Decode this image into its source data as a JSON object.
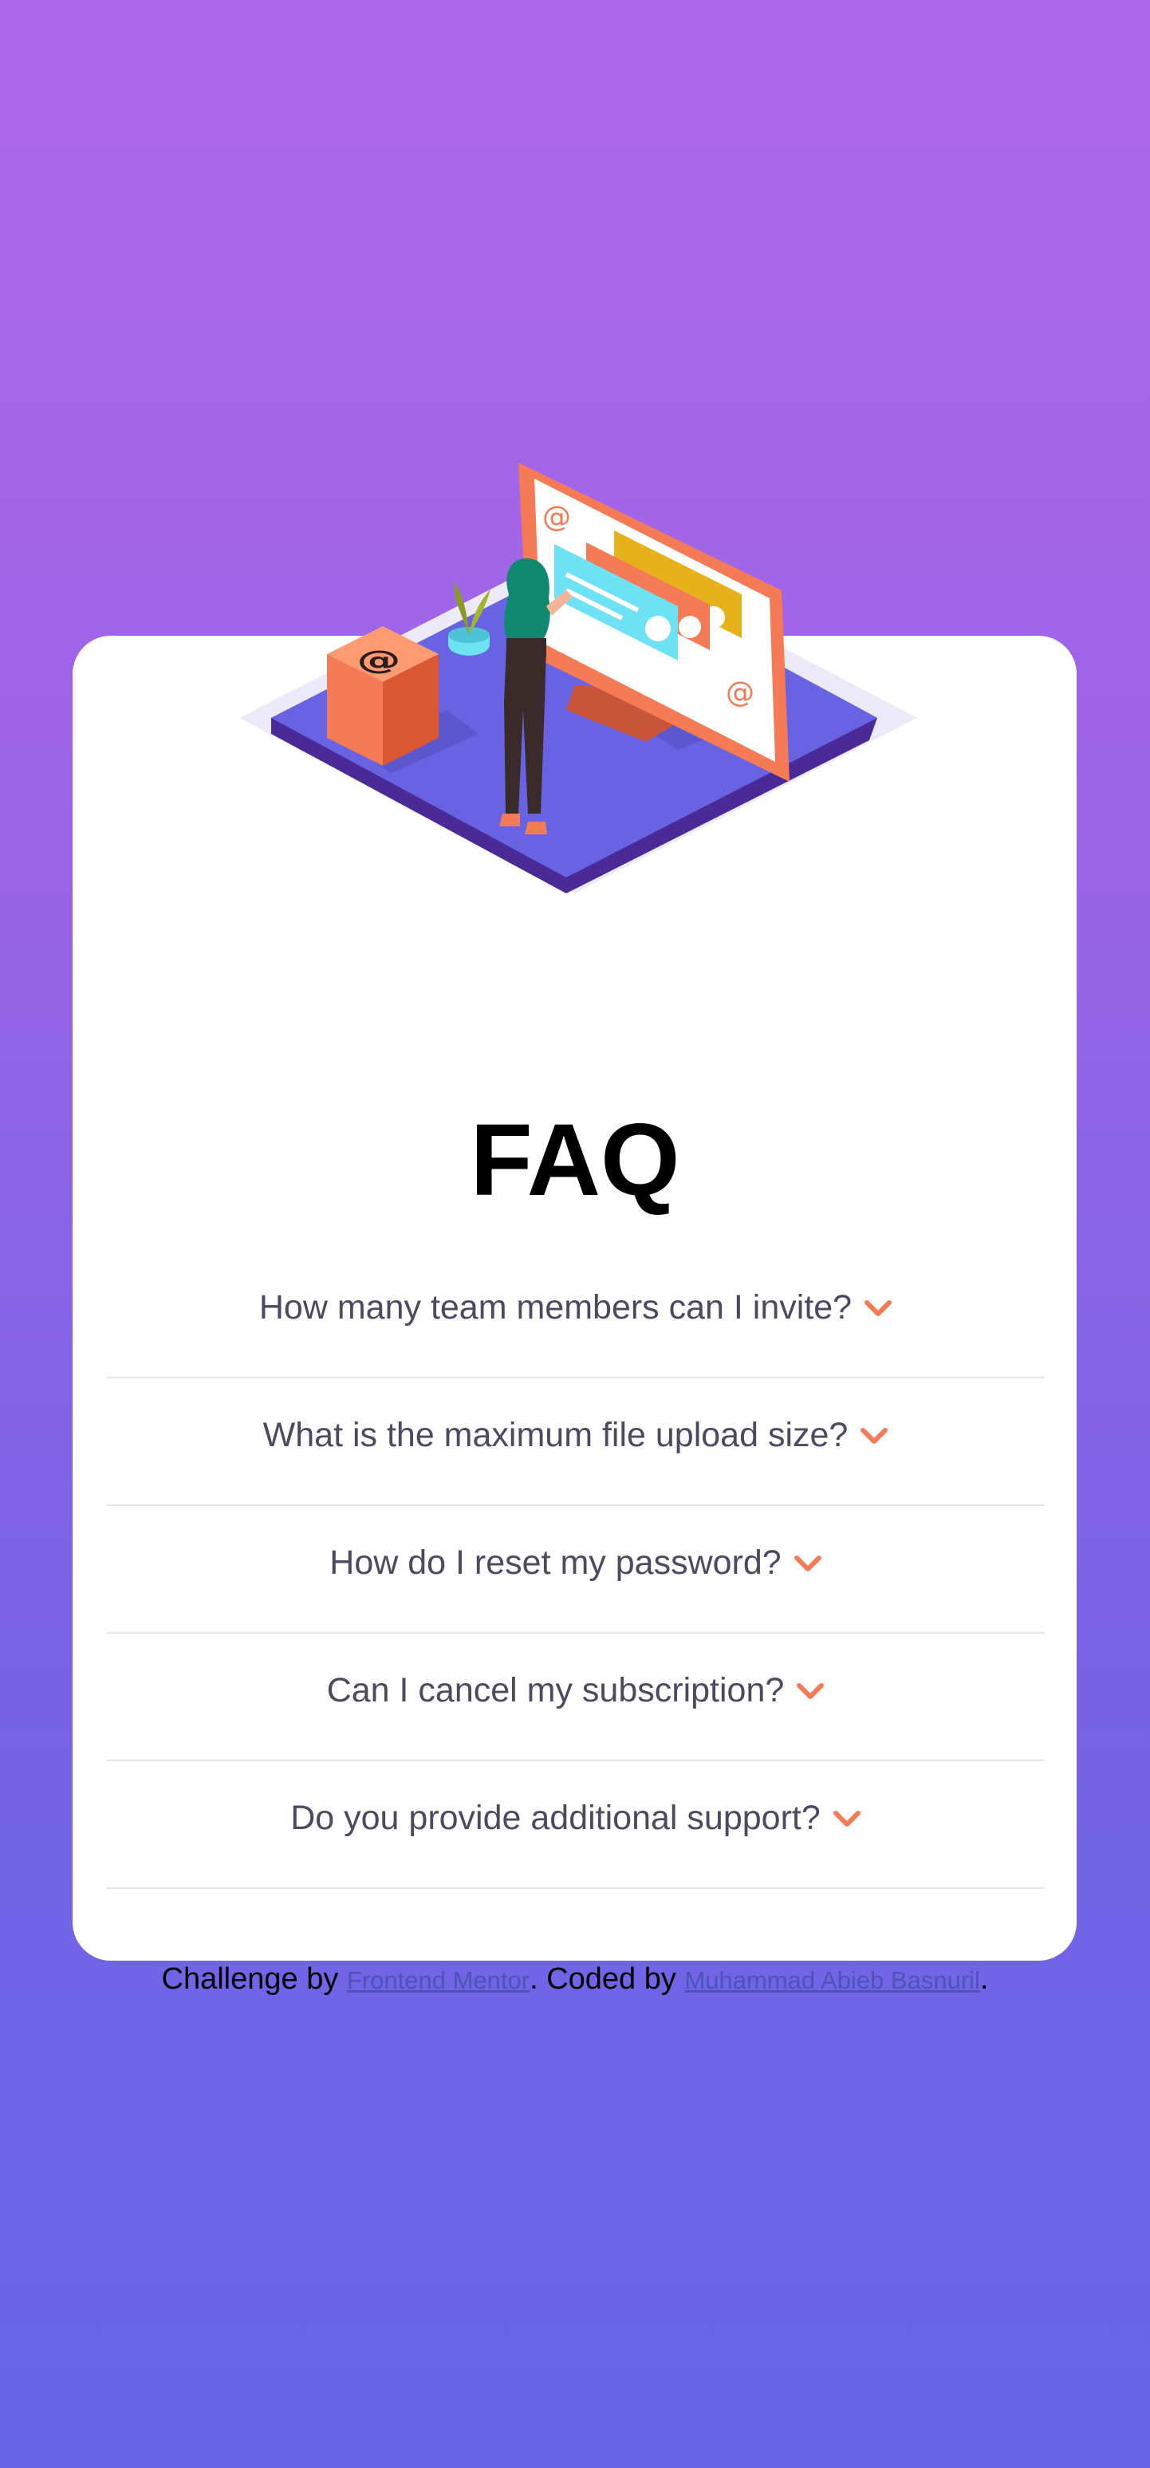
{
  "faq": {
    "title": "FAQ",
    "items": [
      {
        "question": "How many team members can I invite?"
      },
      {
        "question": "What is the maximum file upload size?"
      },
      {
        "question": "How do I reset my password?"
      },
      {
        "question": "Can I cancel my subscription?"
      },
      {
        "question": "Do you provide additional support?"
      }
    ]
  },
  "footer": {
    "prefix": "Challenge by",
    "link1": "Frontend Mentor",
    "middle": ". Coded by",
    "link2": "Muhammad Abieb Basnuril",
    "suffix": "."
  },
  "colors": {
    "background_top": "#ae67ea",
    "background_bottom": "#6565e6",
    "accent": "#f47b56",
    "question_text": "#4a4b5e"
  },
  "icons": {
    "toggle": "chevron-down-icon",
    "hero": "woman-online-illustration"
  }
}
